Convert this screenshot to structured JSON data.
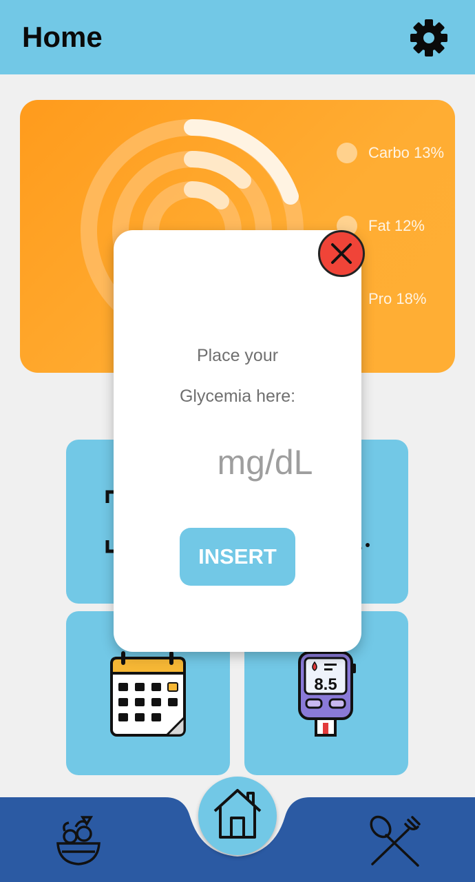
{
  "appbar": {
    "title": "Home",
    "settings_icon": "gear-icon"
  },
  "nutrition_card": {
    "legend": [
      {
        "label": "Carbo 13%",
        "value": 13
      },
      {
        "label": "Fat 12%",
        "value": 12
      },
      {
        "label": "Pro 18%",
        "value": 18
      }
    ],
    "colors": {
      "card": "#ff9f22",
      "ring_track": "#ffbe6b",
      "ring_fill": "#fff1dc"
    }
  },
  "tiles": [
    {
      "icon": "scan-frame-icon"
    },
    {
      "icon": "food-icon"
    },
    {
      "icon": "calendar-icon"
    },
    {
      "icon": "glucose-meter-icon",
      "reading": "8.5"
    }
  ],
  "modal": {
    "line1": "Place your",
    "line2": "Glycemia here:",
    "input_placeholder": "mg/dL",
    "insert_label": "INSERT",
    "close_icon": "close-icon"
  },
  "bottom_nav": {
    "items": [
      {
        "icon": "salad-bowl-icon"
      },
      {
        "icon": "home-icon"
      },
      {
        "icon": "fork-spoon-icon"
      }
    ],
    "colors": {
      "bar": "#2b5aa3",
      "home": "#72c8e6"
    }
  }
}
